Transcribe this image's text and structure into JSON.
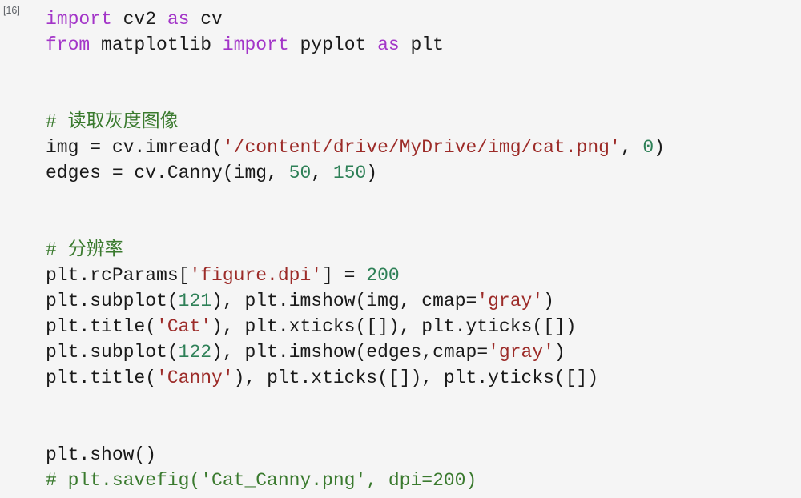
{
  "cell": {
    "exec_count_label": "[16]",
    "background_color": "#f5f5f5",
    "colors": {
      "keyword": "#a335c8",
      "string": "#9c2b28",
      "number": "#2e8057",
      "comment": "#3a7a2e",
      "plain": "#1a1a1a",
      "exec_count": "#5f6368"
    },
    "lines": [
      {
        "id": "line-1",
        "tokens": [
          {
            "t": "kw",
            "v": "import"
          },
          {
            "t": "pln",
            "v": " cv2 "
          },
          {
            "t": "kw",
            "v": "as"
          },
          {
            "t": "pln",
            "v": " cv"
          }
        ]
      },
      {
        "id": "line-2",
        "tokens": [
          {
            "t": "kw",
            "v": "from"
          },
          {
            "t": "pln",
            "v": " matplotlib "
          },
          {
            "t": "kw",
            "v": "import"
          },
          {
            "t": "pln",
            "v": " pyplot "
          },
          {
            "t": "kw",
            "v": "as"
          },
          {
            "t": "pln",
            "v": " plt"
          }
        ]
      },
      {
        "id": "line-3",
        "tokens": []
      },
      {
        "id": "line-4",
        "tokens": []
      },
      {
        "id": "line-5",
        "tokens": [
          {
            "t": "com",
            "v": "# 读取灰度图像"
          }
        ]
      },
      {
        "id": "line-6",
        "tokens": [
          {
            "t": "pln",
            "v": "img = cv.imread("
          },
          {
            "t": "str",
            "v": "'"
          },
          {
            "t": "link",
            "v": "/content/drive/MyDrive/img/cat.png"
          },
          {
            "t": "str",
            "v": "'"
          },
          {
            "t": "pln",
            "v": ", "
          },
          {
            "t": "num",
            "v": "0"
          },
          {
            "t": "pln",
            "v": ")"
          }
        ]
      },
      {
        "id": "line-7",
        "tokens": [
          {
            "t": "pln",
            "v": "edges = cv.Canny(img, "
          },
          {
            "t": "num",
            "v": "50"
          },
          {
            "t": "pln",
            "v": ", "
          },
          {
            "t": "num",
            "v": "150"
          },
          {
            "t": "pln",
            "v": ")"
          }
        ]
      },
      {
        "id": "line-8",
        "tokens": []
      },
      {
        "id": "line-9",
        "tokens": []
      },
      {
        "id": "line-10",
        "tokens": [
          {
            "t": "com",
            "v": "# 分辨率"
          }
        ]
      },
      {
        "id": "line-11",
        "tokens": [
          {
            "t": "pln",
            "v": "plt.rcParams["
          },
          {
            "t": "str",
            "v": "'figure.dpi'"
          },
          {
            "t": "pln",
            "v": "] = "
          },
          {
            "t": "num",
            "v": "200"
          }
        ]
      },
      {
        "id": "line-12",
        "tokens": [
          {
            "t": "pln",
            "v": "plt.subplot("
          },
          {
            "t": "num",
            "v": "121"
          },
          {
            "t": "pln",
            "v": "), plt.imshow(img, cmap="
          },
          {
            "t": "str",
            "v": "'gray'"
          },
          {
            "t": "pln",
            "v": ")"
          }
        ]
      },
      {
        "id": "line-13",
        "tokens": [
          {
            "t": "pln",
            "v": "plt.title("
          },
          {
            "t": "str",
            "v": "'Cat'"
          },
          {
            "t": "pln",
            "v": "), plt.xticks([]), plt.yticks([])"
          }
        ]
      },
      {
        "id": "line-14",
        "tokens": [
          {
            "t": "pln",
            "v": "plt.subplot("
          },
          {
            "t": "num",
            "v": "122"
          },
          {
            "t": "pln",
            "v": "), plt.imshow(edges,cmap="
          },
          {
            "t": "str",
            "v": "'gray'"
          },
          {
            "t": "pln",
            "v": ")"
          }
        ]
      },
      {
        "id": "line-15",
        "tokens": [
          {
            "t": "pln",
            "v": "plt.title("
          },
          {
            "t": "str",
            "v": "'Canny'"
          },
          {
            "t": "pln",
            "v": "), plt.xticks([]), plt.yticks([])"
          }
        ]
      },
      {
        "id": "line-16",
        "tokens": []
      },
      {
        "id": "line-17",
        "tokens": []
      },
      {
        "id": "line-18",
        "tokens": [
          {
            "t": "pln",
            "v": "plt.show()"
          }
        ]
      },
      {
        "id": "line-19",
        "tokens": [
          {
            "t": "com",
            "v": "# plt.savefig('Cat_Canny.png', dpi=200)"
          }
        ]
      }
    ]
  }
}
